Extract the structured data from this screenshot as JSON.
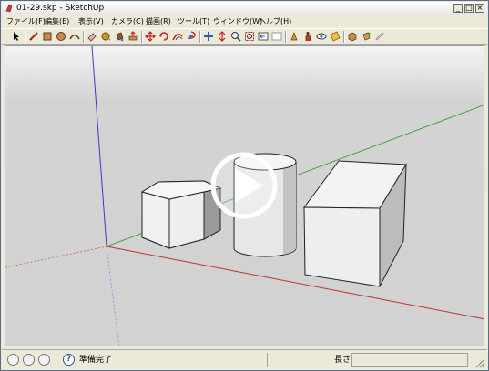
{
  "window": {
    "title": "01-29.skp - SketchUp",
    "min_label": "_",
    "max_label": "□",
    "close_label": "×"
  },
  "menu": {
    "items": [
      "ファイル(F)",
      "編集(E)",
      "表示(V)",
      "カメラ(C)",
      "描画(R)",
      "ツール(T)",
      "ウィンドウ(W)",
      "ヘルプ(H)"
    ]
  },
  "toolbar": {
    "icons": [
      "select-icon",
      "line-icon",
      "rectangle-icon",
      "circle-icon",
      "arc-icon",
      "eraser-icon",
      "tape-measure-icon",
      "paint-bucket-icon",
      "push-pull-icon",
      "move-icon",
      "rotate-icon",
      "offset-icon",
      "orbit-icon",
      "pan-icon",
      "zoom-icon",
      "zoom-extents-icon",
      "previous-view-icon",
      "next-view-icon",
      "position-camera-icon",
      "walk-icon",
      "look-around-icon",
      "components-icon",
      "materials-icon",
      "section-plane-icon"
    ]
  },
  "viewport": {
    "play_overlay": "play-icon"
  },
  "status": {
    "text": "準備完了",
    "vcb_label": "長さ",
    "vcb_value": ""
  },
  "colors": {
    "red_axis": "#c03030",
    "green_axis": "#3aa23a",
    "blue_axis": "#3a3ad0",
    "face": "#ececec",
    "shade": "#b9b9b9"
  }
}
